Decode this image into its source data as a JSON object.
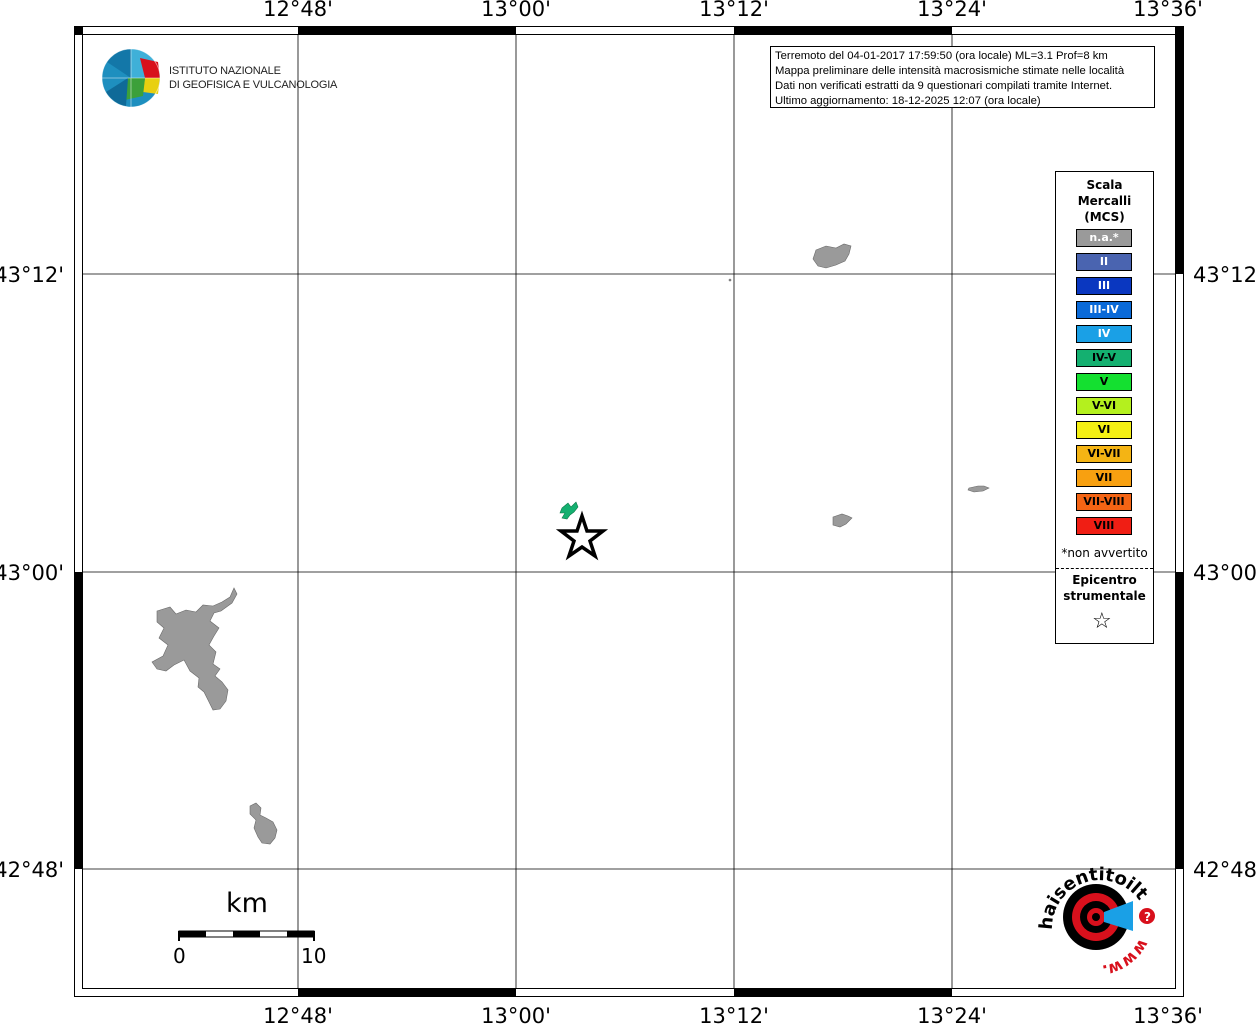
{
  "map": {
    "lon_labels": [
      "12°48'",
      "13°00'",
      "13°12'",
      "13°24'",
      "13°36'"
    ],
    "lat_labels": [
      "43°12'",
      "43°00'",
      "42°48'"
    ]
  },
  "logo": {
    "line1": "ISTITUTO NAZIONALE",
    "line2": "DI GEOFISICA E VULCANOLOGIA"
  },
  "info": {
    "line1": "Terremoto del 04-01-2017 17:59:50 (ora locale) ML=3.1 Prof=8 km",
    "line2": "Mappa preliminare delle intensità macrosismiche stimate nelle località",
    "line3": "Dati non verificati estratti da 9 questionari compilati tramite Internet.",
    "line4": "Ultimo aggiornamento: 18-12-2025 12:07 (ora locale)"
  },
  "legend": {
    "title1": "Scala",
    "title2": "Mercalli",
    "title3": "(MCS)",
    "items": [
      {
        "label": "n.a.*",
        "color": "#9a9a9a",
        "text_color": "#ffffff"
      },
      {
        "label": "II",
        "color": "#4a64b0",
        "text_color": "#ffffff"
      },
      {
        "label": "III",
        "color": "#0a37c0",
        "text_color": "#ffffff"
      },
      {
        "label": "III-IV",
        "color": "#0a6ad8",
        "text_color": "#ffffff"
      },
      {
        "label": "IV",
        "color": "#1aa0e6",
        "text_color": "#ffffff"
      },
      {
        "label": "IV-V",
        "color": "#14b070",
        "text_color": "#000000"
      },
      {
        "label": "V",
        "color": "#14e030",
        "text_color": "#000000"
      },
      {
        "label": "V-VI",
        "color": "#b4f01e",
        "text_color": "#000000"
      },
      {
        "label": "VI",
        "color": "#f4f014",
        "text_color": "#000000"
      },
      {
        "label": "VI-VII",
        "color": "#f4b414",
        "text_color": "#000000"
      },
      {
        "label": "VII",
        "color": "#f8a010",
        "text_color": "#000000"
      },
      {
        "label": "VII-VIII",
        "color": "#f46414",
        "text_color": "#000000"
      },
      {
        "label": "VIII",
        "color": "#f01e14",
        "text_color": "#000000"
      }
    ],
    "note": "*non avvertito",
    "epicentro1": "Epicentro",
    "epicentro2": "strumentale"
  },
  "scale_bar": {
    "unit": "km",
    "min_label": "0",
    "max_label": "10"
  },
  "badge": {
    "text": "haisentitoilterremoto.it",
    "url": "www."
  },
  "colors": {
    "town_na": "#9a9a9a",
    "town_ivv": "#14b070"
  }
}
